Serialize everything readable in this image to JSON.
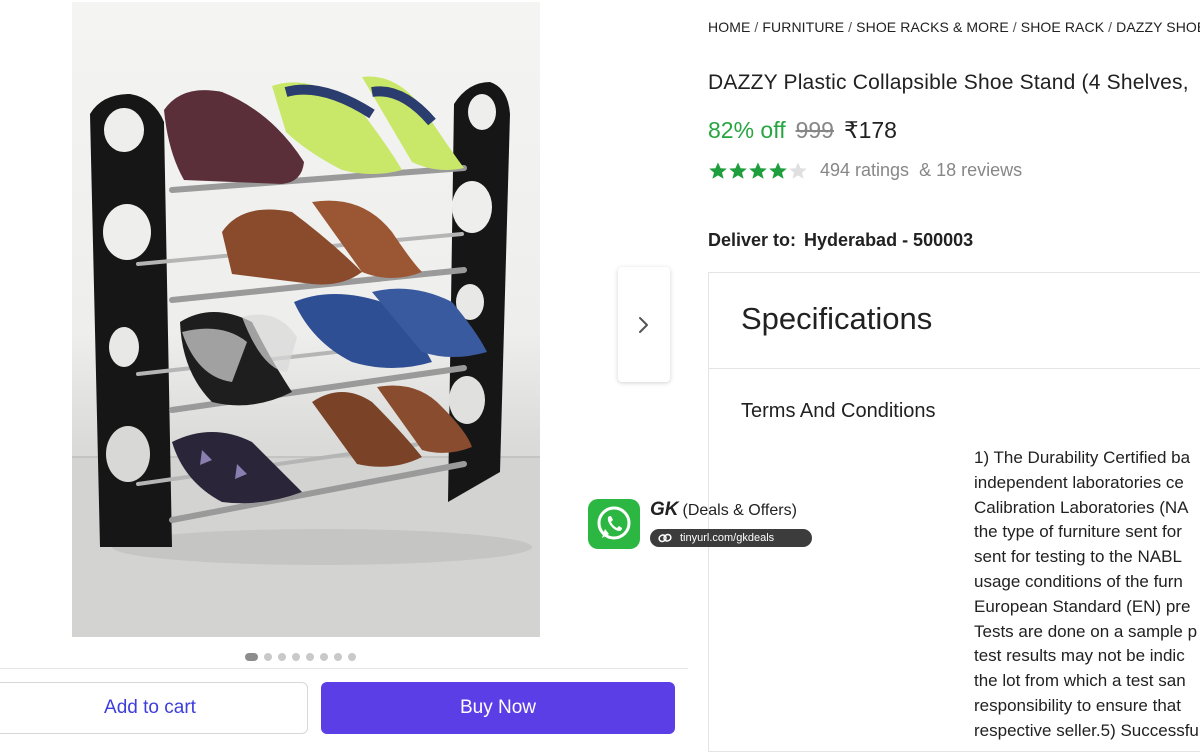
{
  "breadcrumb": [
    "HOME",
    "FURNITURE",
    "SHOE RACKS & MORE",
    "SHOE RACK",
    "DAZZY SHOE RACK"
  ],
  "product": {
    "title": "DAZZY Plastic Collapsible Shoe Stand (4 Shelves,",
    "discount": "82% off",
    "mrp": "999",
    "price": "₹178",
    "rating_value": 4,
    "ratings": "494 ratings",
    "reviews": "& 18 reviews"
  },
  "delivery": {
    "label": "Deliver to:",
    "location": "Hyderabad - 500003"
  },
  "specs": {
    "heading": "Specifications",
    "terms_label": "Terms And Conditions",
    "terms_lines": [
      "1) The Durability Certified ba",
      "independent laboratories ce",
      "Calibration Laboratories (NA",
      "the type of furniture sent for",
      "sent for testing to the NABL",
      "usage conditions of the furn",
      "European Standard (EN) pre",
      "Tests are done on a sample p",
      "test results may not be indic",
      "the lot from which a test san",
      "responsibility to ensure that",
      "respective seller.5) Successfu"
    ]
  },
  "gallery": {
    "dot_count": 8,
    "active_index": 0
  },
  "actions": {
    "add_to_cart": "Add to cart",
    "buy_now": "Buy Now"
  },
  "watermark": {
    "brand": "GK",
    "tagline": "(Deals & Offers)",
    "url": "tinyurl.com/gkdeals"
  },
  "colors": {
    "discount_green": "#26a541",
    "star_green": "#1e9e3c",
    "buy_button": "#5b3ee6",
    "cart_text": "#3d3ddb"
  },
  "icons": {
    "next": "chevron-right-icon",
    "whatsapp": "whatsapp-icon",
    "link": "link-icon",
    "star": "star-icon"
  }
}
